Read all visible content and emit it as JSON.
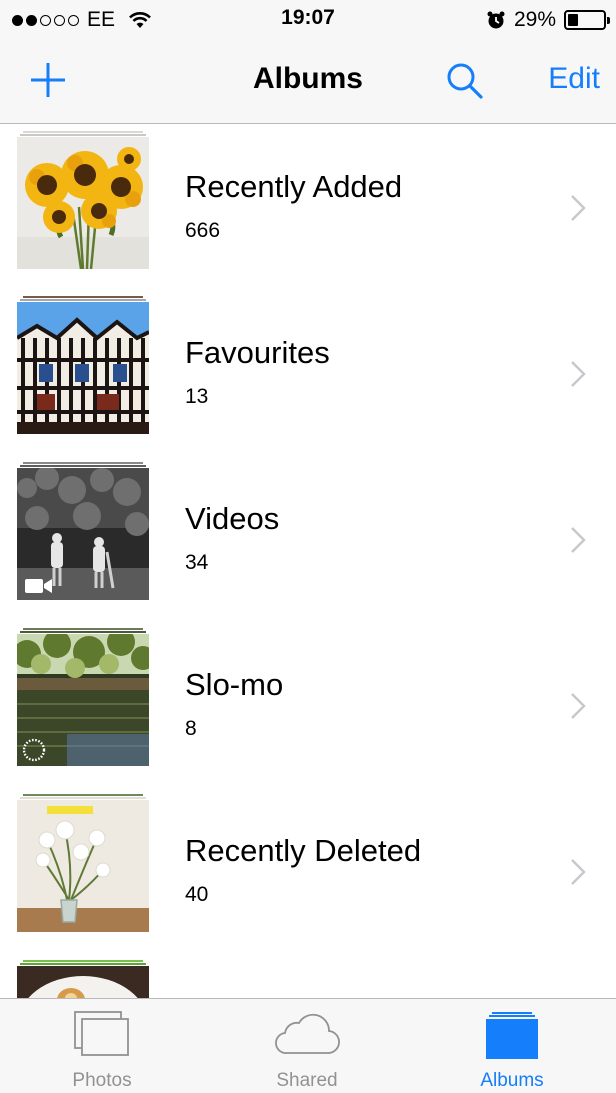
{
  "status_bar": {
    "carrier": "EE",
    "time": "19:07",
    "battery_percent": "29%",
    "battery_level": 0.29,
    "signal_bars_filled": 2,
    "signal_bars_total": 5
  },
  "nav": {
    "title": "Albums",
    "add_icon": "plus-icon",
    "search_icon": "search-icon",
    "edit_label": "Edit"
  },
  "albums": [
    {
      "title": "Recently Added",
      "count": "666"
    },
    {
      "title": "Favourites",
      "count": "13"
    },
    {
      "title": "Videos",
      "count": "34"
    },
    {
      "title": "Slo-mo",
      "count": "8"
    },
    {
      "title": "Recently Deleted",
      "count": "40"
    }
  ],
  "tabs": [
    {
      "label": "Photos",
      "icon": "photos-stack-icon",
      "active": false
    },
    {
      "label": "Shared",
      "icon": "cloud-icon",
      "active": false
    },
    {
      "label": "Albums",
      "icon": "albums-icon",
      "active": true
    }
  ],
  "colors": {
    "accent": "#147efb",
    "inactive_tab": "#929292",
    "bar_background": "#f7f7f7",
    "separator": "#b9b9bd"
  }
}
